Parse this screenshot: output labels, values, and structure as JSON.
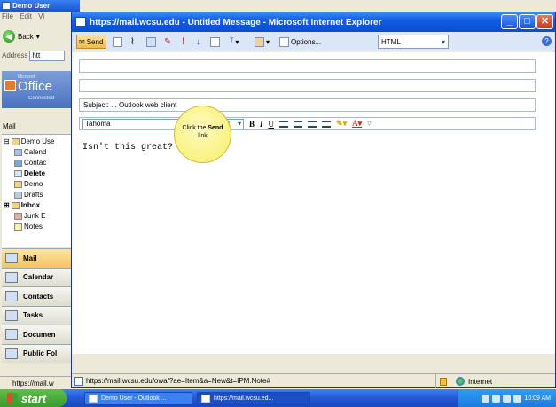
{
  "background_window": {
    "title": "Demo User",
    "menu": [
      "File",
      "Edit",
      "Vi"
    ],
    "back_label": "Back",
    "address_label": "Address",
    "address_value": "htt",
    "banner_sub": "Microsoft",
    "banner_title": "Office",
    "banner_status": "Connected",
    "mail_label": "Mail",
    "tree": [
      "Demo Use",
      "Calend",
      "Contac",
      "Delete",
      "Demo",
      "Drafts",
      "Inbox",
      "Junk E",
      "Notes"
    ],
    "nav": [
      "Mail",
      "Calendar",
      "Contacts",
      "Tasks",
      "Documen",
      "Public Fol"
    ],
    "status": "https://mail.w"
  },
  "ie": {
    "title": "https://mail.wcsu.edu - Untitled Message - Microsoft Internet Explorer",
    "toolbar": {
      "send_label": "Send",
      "options_label": "Options...",
      "format_value": "HTML"
    },
    "subject_value": "Subject: ... Outlook web client",
    "font_value": "Tahoma",
    "size_value": "10",
    "body_text": "Isn't this great?",
    "bubble_text_1": "Click the",
    "bubble_text_bold": "Send",
    "bubble_text_2": "link",
    "status_url": "https://mail.wcsu.edu/owa/?ae=Item&a=New&t=IPM.Note#",
    "zone_label": "Internet"
  },
  "taskbar": {
    "start_label": "start",
    "tasks": [
      "Demo User - Outlook ...",
      "https://mail.wcsu.ed..."
    ],
    "clock": "10:09 AM"
  }
}
